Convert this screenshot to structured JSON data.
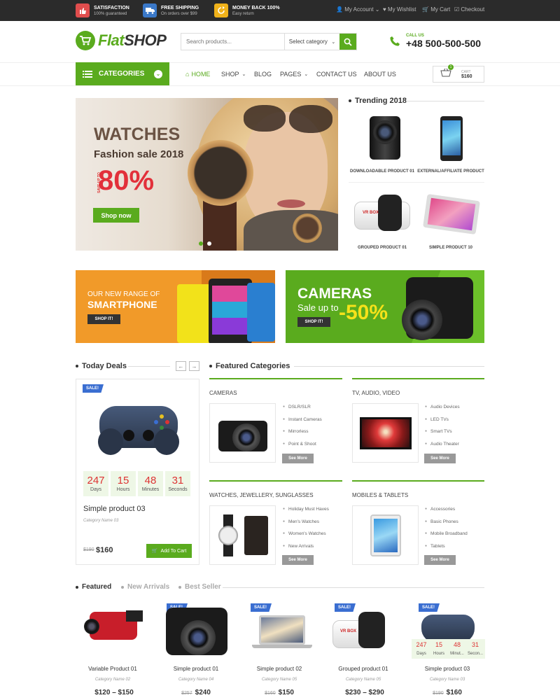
{
  "topbar": {
    "features": [
      {
        "title": "SATISFACTION",
        "sub": "100% guaranteed",
        "icon": "thumb-icon",
        "color": "#e04d4d"
      },
      {
        "title": "FREE SHIPPING",
        "sub": "On orders over $99",
        "icon": "truck-icon",
        "color": "#3a78c8"
      },
      {
        "title": "MONEY BACK 100%",
        "sub": "Easy return",
        "icon": "refresh-icon",
        "color": "#f0b21a"
      }
    ],
    "links": {
      "account": "My Account",
      "wishlist": "My Wishlist",
      "cart": "My Cart",
      "checkout": "Checkout"
    }
  },
  "header": {
    "logo_part1": "Flat",
    "logo_part2": "SHOP",
    "search_placeholder": "Search products...",
    "category_select": "Select category",
    "call_label": "CALL US",
    "phone": "+48 500-500-500"
  },
  "nav": {
    "categories": "CATEGORIES",
    "items": [
      "HOME",
      "SHOP",
      "BLOG",
      "PAGES",
      "CONTACT US",
      "ABOUT US"
    ],
    "cart_label": "CART",
    "cart_total": "$160",
    "cart_count": "1"
  },
  "hero": {
    "title": "WATCHES",
    "subtitle": "Fashion sale 2018",
    "save_label": "SAVE UP TO",
    "percent": "80%",
    "button": "Shop now"
  },
  "trending": {
    "title": "Trending 2018",
    "items": [
      "DOWNLOADABLE PRODUCT 01",
      "EXTERNAL/AFFILIATE PRODUCT",
      "GROUPED PRODUCT 01",
      "SIMPLE PRODUCT 10"
    ]
  },
  "banners": {
    "phone": {
      "line1": "OUR NEW RANGE OF",
      "line2": "SMARTPHONE",
      "button": "SHOP IT!"
    },
    "camera": {
      "line1": "CAMERAS",
      "line2": "Sale up to",
      "percent": "-50%",
      "button": "SHOP IT!"
    }
  },
  "deals": {
    "title": "Today Deals",
    "badge": "SALE!",
    "countdown": [
      {
        "value": "247",
        "label": "Days"
      },
      {
        "value": "15",
        "label": "Hours"
      },
      {
        "value": "48",
        "label": "Minutes"
      },
      {
        "value": "31",
        "label": "Seconds"
      }
    ],
    "product": "Simple product 03",
    "category": "Category Name 03",
    "old_price": "$190",
    "price": "$160",
    "add_to_cart": "Add To Cart"
  },
  "featured_categories": {
    "title": "Featured Categories",
    "see_more": "See More",
    "groups": [
      {
        "name": "CAMERAS",
        "items": [
          "DSLR/SLR",
          "Instant Cameras",
          "Mirrorless",
          "Point & Shoot"
        ]
      },
      {
        "name": "TV, AUDIO, VIDEO",
        "items": [
          "Audio Devices",
          "LED TVs",
          "Smart TVs",
          "Audio Theater"
        ]
      },
      {
        "name": "WATCHES, JEWELLERY, SUNGLASSES",
        "items": [
          "Holiday Must Haves",
          "Men's Watches",
          "Women's Watches",
          "New Arrivals"
        ]
      },
      {
        "name": "MOBILES & TABLETS",
        "items": [
          "Accessories",
          "Basic Phones",
          "Mobile Broadband",
          "Tablets"
        ]
      }
    ]
  },
  "product_tabs": {
    "tabs": [
      "Featured",
      "New Arrivals",
      "Best Seller"
    ],
    "badge": "SALE!",
    "products": [
      {
        "name": "Variable Product 01",
        "category": "Category Name 02",
        "old": "",
        "price": "$120 – $150"
      },
      {
        "name": "Simple product 01",
        "category": "Category Name 04",
        "old": "$257",
        "price": "$240"
      },
      {
        "name": "Simple product 02",
        "category": "Category Name 05",
        "old": "$160",
        "price": "$150"
      },
      {
        "name": "Grouped product 01",
        "category": "Category Name 05",
        "old": "",
        "price": "$230 – $290"
      },
      {
        "name": "Simple product 03",
        "category": "Category Name 03",
        "old": "$190",
        "price": "$160"
      }
    ],
    "mini_countdown": [
      {
        "value": "247",
        "label": "Days"
      },
      {
        "value": "15",
        "label": "Hours"
      },
      {
        "value": "48",
        "label": "Minut..."
      },
      {
        "value": "31",
        "label": "Secon..."
      }
    ]
  }
}
